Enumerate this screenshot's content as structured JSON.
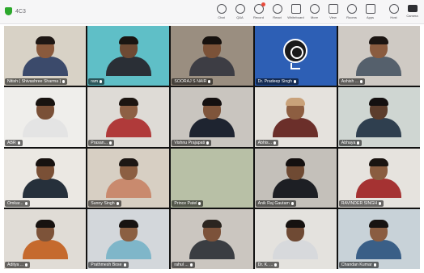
{
  "toolbar": {
    "version": "4C3",
    "items": [
      {
        "label": "Chat",
        "icon": "chat-icon"
      },
      {
        "label": "Q&A",
        "icon": "qa-icon"
      },
      {
        "label": "Record",
        "icon": "record-icon"
      },
      {
        "label": "React",
        "icon": "react-icon"
      },
      {
        "label": "Whiteboard",
        "icon": "whiteboard-icon"
      },
      {
        "label": "More",
        "icon": "more-icon"
      },
      {
        "label": "View",
        "icon": "view-icon"
      },
      {
        "label": "Rooms",
        "icon": "rooms-icon"
      },
      {
        "label": "Apps",
        "icon": "apps-icon"
      },
      {
        "label": "Host",
        "icon": "host-icon"
      },
      {
        "label": "Camera",
        "icon": "camera-icon"
      }
    ]
  },
  "participants": [
    {
      "name": "Nitish ( Shivashree Sharma )",
      "bg": "#d8d2c6",
      "skin": "#8a5a3d",
      "hair": "#1e1714",
      "shirt": "#3b4a6b"
    },
    {
      "name": "ram",
      "bg": "#5fbfc7",
      "skin": "#6e4a34",
      "hair": "#1a1512",
      "shirt": "#2a2f36"
    },
    {
      "name": "SOORAJ S NAIR",
      "bg": "#9a8e80",
      "skin": "#7b5238",
      "hair": "#16110e",
      "shirt": "#3d3d44"
    },
    {
      "name": "Dr. Pradeep Singh",
      "bg": "#2d5fb5",
      "skin": "",
      "hair": "",
      "shirt": "",
      "obs": true
    },
    {
      "name": "Ashish ...",
      "bg": "#cfcac4",
      "skin": "#8a5c40",
      "hair": "#1b1512",
      "shirt": "#55606c"
    },
    {
      "name": "ABR",
      "bg": "#efeeeb",
      "skin": "#7a5037",
      "hair": "#181310",
      "shirt": "#e4e4e4"
    },
    {
      "name": "Prasan...",
      "bg": "#dedbd6",
      "skin": "#8d6044",
      "hair": "#1c1511",
      "shirt": "#b03a3a"
    },
    {
      "name": "Vishnu Prajapati",
      "bg": "#c9c5bf",
      "skin": "#7f553b",
      "hair": "#141010",
      "shirt": "#1e2430"
    },
    {
      "name": "Abhis...",
      "bg": "#e5e2dd",
      "skin": "#8d5e41",
      "hair": "#c9a27a",
      "shirt": "#6b2f2a"
    },
    {
      "name": "Abhaya",
      "bg": "#cfd6d2",
      "skin": "#5c3d2c",
      "hair": "#141010",
      "shirt": "#2f3f4f"
    },
    {
      "name": "Omkar...",
      "bg": "#ebe8e3",
      "skin": "#7a5036",
      "hair": "#171210",
      "shirt": "#26303b"
    },
    {
      "name": "Sunny Singh",
      "bg": "#d7cfc3",
      "skin": "#8c5f42",
      "hair": "#1d1714",
      "shirt": "#c98a6e"
    },
    {
      "name": "Prince Patel",
      "bg": "#b8c0a6",
      "skin": "",
      "hair": "",
      "shirt": "",
      "empty": true
    },
    {
      "name": "Anik Raj Gautam",
      "bg": "#c4c0ba",
      "skin": "#6f4a33",
      "hair": "#141010",
      "shirt": "#1d1f24"
    },
    {
      "name": "RAVINDER SINGH",
      "bg": "#e6e3de",
      "skin": "#8a5d40",
      "hair": "#1a1411",
      "shirt": "#a53232"
    },
    {
      "name": "Aditya ...",
      "bg": "#e0dcd6",
      "skin": "#7d5339",
      "hair": "#171210",
      "shirt": "#c56a2e"
    },
    {
      "name": "Prathmesh Bose",
      "bg": "#d3d7db",
      "skin": "#8b5f42",
      "hair": "#181311",
      "shirt": "#7fb6c9"
    },
    {
      "name": "rahul ...",
      "bg": "#cbc6c0",
      "skin": "#7c523a",
      "hair": "#2b2520",
      "shirt": "#3a3d42"
    },
    {
      "name": "Dr. K. ...",
      "bg": "#e4e2de",
      "skin": "#6f4a34",
      "hair": "#161210",
      "shirt": "#d7d9dc"
    },
    {
      "name": "Chandan Kumar",
      "bg": "#c8d2d8",
      "skin": "#8a5d41",
      "hair": "#181311",
      "shirt": "#3a5f87"
    }
  ]
}
